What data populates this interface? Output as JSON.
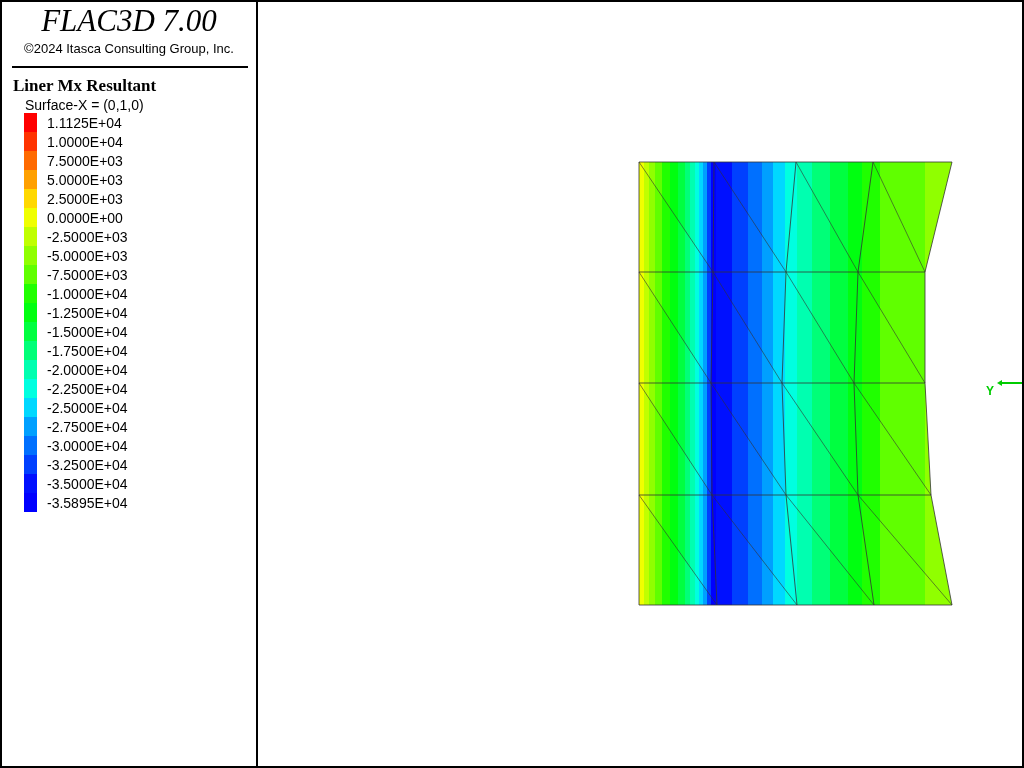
{
  "title": "FLAC3D 7.00",
  "copyright": "©2024 Itasca Consulting Group, Inc.",
  "plot_title": "Liner Mx Resultant",
  "subtitle": "Surface-X = (0,1,0)",
  "legend": [
    {
      "label": "1.1125E+04",
      "color": "#ff0000"
    },
    {
      "label": "1.0000E+04",
      "color": "#ff3300"
    },
    {
      "label": "7.5000E+03",
      "color": "#ff6a00"
    },
    {
      "label": "5.0000E+03",
      "color": "#ffa000"
    },
    {
      "label": "2.5000E+03",
      "color": "#ffd800"
    },
    {
      "label": "0.0000E+00",
      "color": "#f0ff00"
    },
    {
      "label": "-2.5000E+03",
      "color": "#c0ff00"
    },
    {
      "label": "-5.0000E+03",
      "color": "#90ff00"
    },
    {
      "label": "-7.5000E+03",
      "color": "#60ff00"
    },
    {
      "label": "-1.0000E+04",
      "color": "#20ff00"
    },
    {
      "label": "-1.2500E+04",
      "color": "#00ff10"
    },
    {
      "label": "-1.5000E+04",
      "color": "#00ff40"
    },
    {
      "label": "-1.7500E+04",
      "color": "#00ff78"
    },
    {
      "label": "-2.0000E+04",
      "color": "#00ffb0"
    },
    {
      "label": "-2.2500E+04",
      "color": "#00ffe0"
    },
    {
      "label": "-2.5000E+04",
      "color": "#00d8ff"
    },
    {
      "label": "-2.7500E+04",
      "color": "#00a0ff"
    },
    {
      "label": "-3.0000E+04",
      "color": "#0070ff"
    },
    {
      "label": "-3.2500E+04",
      "color": "#0040ff"
    },
    {
      "label": "-3.5000E+04",
      "color": "#0010ff"
    },
    {
      "label": "-3.5895E+04",
      "color": "#0000ff"
    }
  ],
  "axis_label": "Y"
}
